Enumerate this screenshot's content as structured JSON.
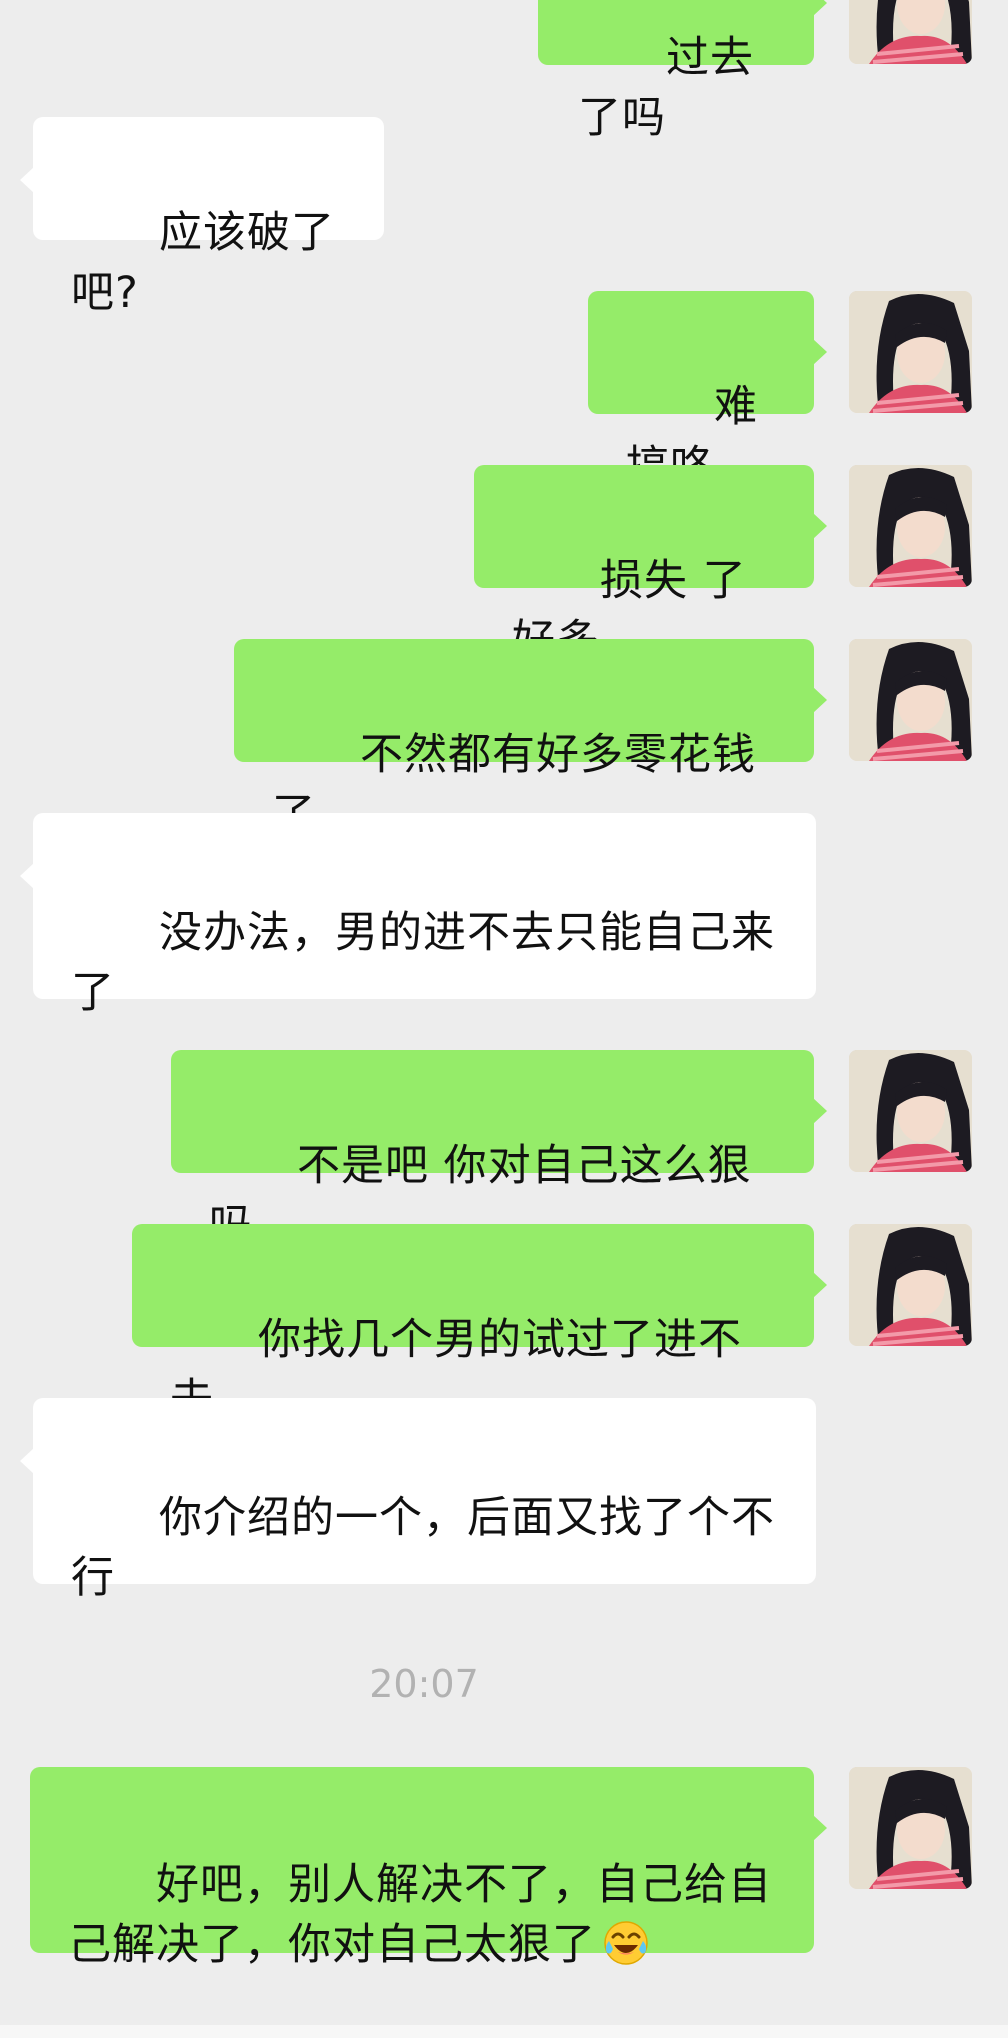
{
  "messages": [
    {
      "side": "out",
      "text": "过去了吗"
    },
    {
      "side": "in",
      "text": "应该破了吧?"
    },
    {
      "side": "out",
      "text": "难搞咯"
    },
    {
      "side": "out",
      "text": "损失 了好多"
    },
    {
      "side": "out",
      "text": "不然都有好多零花钱了"
    },
    {
      "side": "in",
      "text": "没办法，男的进不去只能自己来了"
    },
    {
      "side": "out",
      "text": "不是吧 你对自己这么狠吗"
    },
    {
      "side": "out",
      "text": "你找几个男的试过了进不去"
    },
    {
      "side": "in",
      "text": "你介绍的一个，后面又找了个不行"
    },
    {
      "side": "out",
      "text": "好吧，别人解决不了，自己给自己解决了，你对自己太狠了",
      "emoji": "tears-of-joy-emoji-icon"
    }
  ],
  "timestamp": "20:07",
  "colors": {
    "background": "#ededed",
    "incoming_bubble": "#ffffff",
    "outgoing_bubble": "#95ec69",
    "timestamp_text": "#b2b2b2"
  }
}
